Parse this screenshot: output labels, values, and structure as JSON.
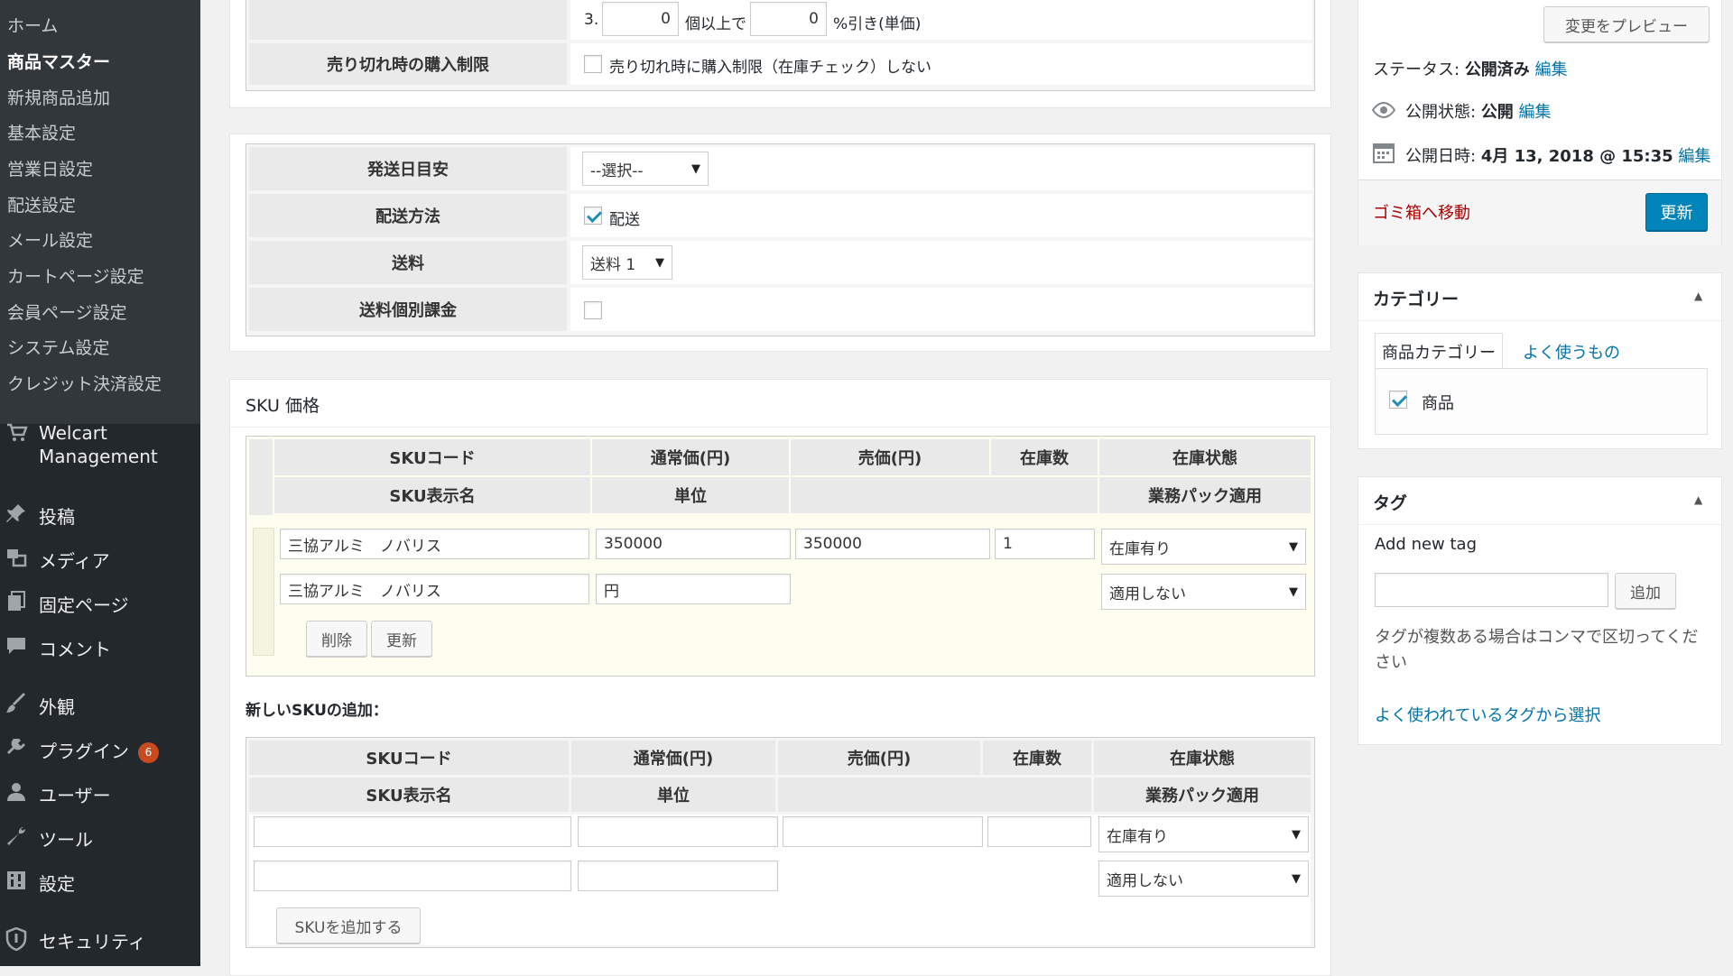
{
  "sidebar": {
    "submenu": [
      "ホーム",
      "商品マスター",
      "新規商品追加",
      "基本設定",
      "営業日設定",
      "配送設定",
      "メール設定",
      "カートページ設定",
      "会員ページ設定",
      "システム設定",
      "クレジット決済設定"
    ],
    "welcart_line1": "Welcart",
    "welcart_line2": "Management",
    "menu": {
      "posts": "投稿",
      "media": "メディア",
      "pages": "固定ページ",
      "comments": "コメント",
      "appearance": "外観",
      "plugins": "プラグイン",
      "plugins_badge": "6",
      "users": "ユーザー",
      "tools": "ツール",
      "settings": "設定",
      "security": "セキュリティ"
    }
  },
  "discount": {
    "prefix": "3.",
    "qty": "0",
    "qty_suffix": "個以上で",
    "pct": "0",
    "pct_suffix": "%引き(単価)"
  },
  "soldout": {
    "label": "売り切れ時の購入制限",
    "checkbox_text": "売り切れ時に購入制限（在庫チェック）しない"
  },
  "shipping": {
    "ship_date_label": "発送日目安",
    "ship_date_value": "--選択--",
    "method_label": "配送方法",
    "method_option": "配送",
    "fee_label": "送料",
    "fee_value": "送料 1",
    "individual_label": "送料個別課金"
  },
  "sku": {
    "title": "SKU 価格",
    "headers": {
      "code": "SKUコード",
      "regular": "通常価(円)",
      "sale": "売価(円)",
      "stock": "在庫数",
      "status": "在庫状態",
      "display_name": "SKU表示名",
      "unit": "単位",
      "pack": "業務パック適用"
    },
    "row": {
      "code": "三協アルミ　ノバリス",
      "regular": "350000",
      "sale": "350000",
      "stock": "1",
      "status": "在庫有り",
      "display_name": "三協アルミ　ノバリス",
      "unit": "円",
      "pack": "適用しない"
    },
    "delete_btn": "削除",
    "update_btn": "更新",
    "new_title": "新しいSKUの追加：",
    "new_status": "在庫有り",
    "new_pack": "適用しない",
    "add_btn": "SKUを追加する"
  },
  "publish": {
    "preview_btn": "変更をプレビュー",
    "status_label": "ステータス:",
    "status_value": "公開済み",
    "visibility_label": "公開状態:",
    "visibility_value": "公開",
    "date_label": "公開日時:",
    "date_value": "4月 13, 2018 @ 15:35",
    "edit": "編集",
    "trash": "ゴミ箱へ移動",
    "update_btn": "更新"
  },
  "category": {
    "title": "カテゴリー",
    "tab_all": "商品カテゴリー",
    "tab_popular": "よく使うもの",
    "item": "商品"
  },
  "tags": {
    "title": "タグ",
    "add_new": "Add new tag",
    "add_btn": "追加",
    "hint": "タグが複数ある場合はコンマで区切ってください",
    "choose_link": "よく使われているタグから選択"
  }
}
